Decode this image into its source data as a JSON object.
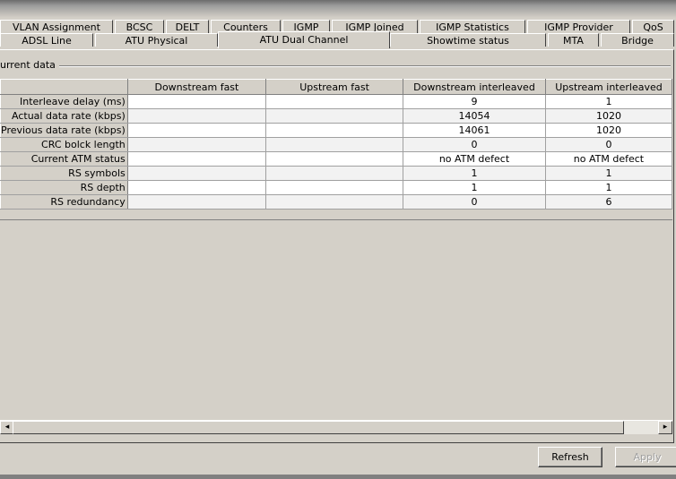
{
  "tabs": {
    "row1": [
      "VLAN Assignment",
      "BCSC",
      "DELT",
      "Counters",
      "IGMP",
      "IGMP Joined",
      "IGMP Statistics",
      "IGMP Provider",
      "QoS"
    ],
    "row2": [
      "ADSL Line",
      "ATU Physical",
      "ATU Dual Channel",
      "Showtime status",
      "MTA",
      "Bridge"
    ],
    "active": "ATU Dual Channel"
  },
  "group": {
    "title": "urrent data"
  },
  "table": {
    "columns": [
      "",
      "Downstream fast",
      "Upstream fast",
      "Downstream interleaved",
      "Upstream interleaved"
    ],
    "rows": [
      {
        "label": "Interleave delay (ms)",
        "cells": [
          "",
          "",
          "9",
          "1"
        ]
      },
      {
        "label": "Actual data rate (kbps)",
        "cells": [
          "",
          "",
          "14054",
          "1020"
        ]
      },
      {
        "label": "Previous data rate (kbps)",
        "cells": [
          "",
          "",
          "14061",
          "1020"
        ]
      },
      {
        "label": "CRC bolck length",
        "cells": [
          "",
          "",
          "0",
          "0"
        ]
      },
      {
        "label": "Current ATM status",
        "cells": [
          "",
          "",
          "no ATM defect",
          "no ATM defect"
        ]
      },
      {
        "label": "RS symbols",
        "cells": [
          "",
          "",
          "1",
          "1"
        ]
      },
      {
        "label": "RS depth",
        "cells": [
          "",
          "",
          "1",
          "1"
        ]
      },
      {
        "label": "RS redundancy",
        "cells": [
          "",
          "",
          "0",
          "6"
        ]
      }
    ]
  },
  "scrollbar": {
    "left_arrow": "◂",
    "right_arrow": "▸"
  },
  "buttons": {
    "refresh": "Refresh",
    "apply": "Apply"
  }
}
